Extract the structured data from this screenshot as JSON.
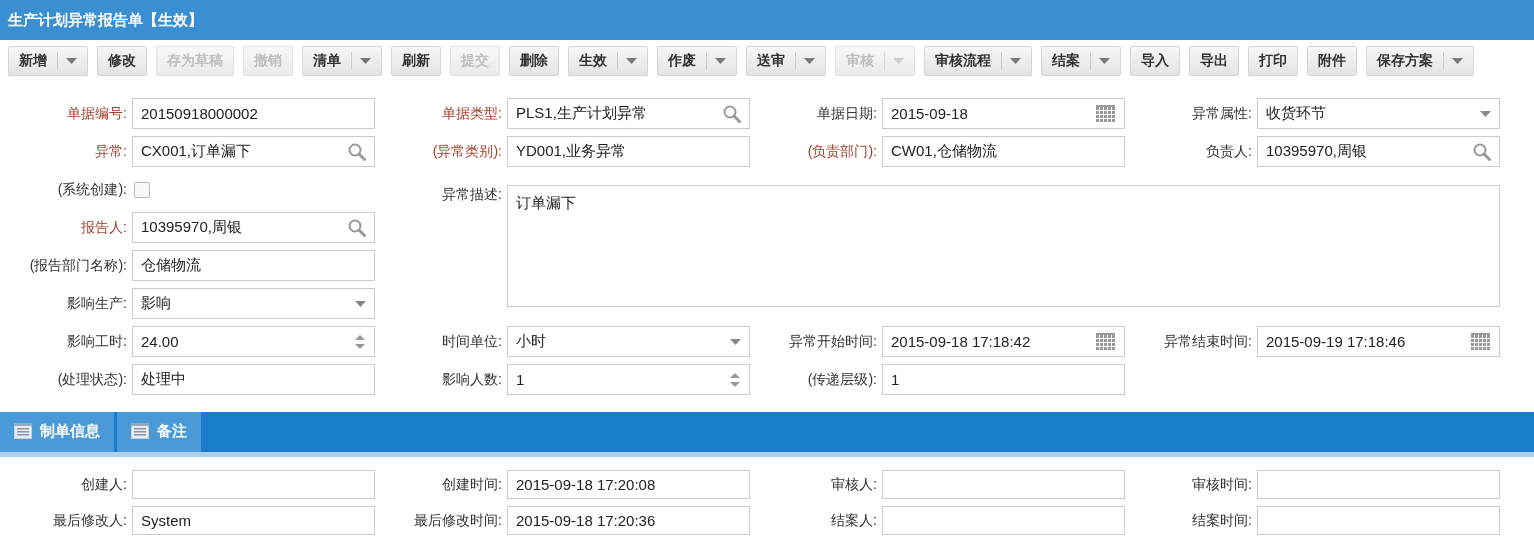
{
  "title": "生产计划异常报告单【生效】",
  "toolbar": [
    {
      "label": "新增",
      "dropdown": true,
      "disabled": false
    },
    {
      "label": "修改",
      "dropdown": false,
      "disabled": false
    },
    {
      "label": "存为草稿",
      "dropdown": false,
      "disabled": true
    },
    {
      "label": "撤销",
      "dropdown": false,
      "disabled": true
    },
    {
      "label": "清单",
      "dropdown": true,
      "disabled": false
    },
    {
      "label": "刷新",
      "dropdown": false,
      "disabled": false
    },
    {
      "label": "提交",
      "dropdown": false,
      "disabled": true
    },
    {
      "label": "删除",
      "dropdown": false,
      "disabled": false
    },
    {
      "label": "生效",
      "dropdown": true,
      "disabled": false
    },
    {
      "label": "作废",
      "dropdown": true,
      "disabled": false
    },
    {
      "label": "送审",
      "dropdown": true,
      "disabled": false
    },
    {
      "label": "审核",
      "dropdown": true,
      "disabled": true
    },
    {
      "label": "审核流程",
      "dropdown": true,
      "disabled": false
    },
    {
      "label": "结案",
      "dropdown": true,
      "disabled": false
    },
    {
      "label": "导入",
      "dropdown": false,
      "disabled": false
    },
    {
      "label": "导出",
      "dropdown": false,
      "disabled": false
    },
    {
      "label": "打印",
      "dropdown": false,
      "disabled": false
    },
    {
      "label": "附件",
      "dropdown": false,
      "disabled": false
    },
    {
      "label": "保存方案",
      "dropdown": true,
      "disabled": false
    }
  ],
  "form": [
    {
      "label": "单据编号:",
      "required": true,
      "kind": "text",
      "value": "20150918000002"
    },
    {
      "label": "单据类型:",
      "required": true,
      "kind": "lookup",
      "value": "PLS1,生产计划异常"
    },
    {
      "label": "单据日期:",
      "required": false,
      "kind": "date",
      "value": "2015-09-18"
    },
    {
      "label": "异常属性:",
      "required": false,
      "kind": "select",
      "value": "收货环节"
    },
    {
      "label": "异常:",
      "required": true,
      "kind": "lookup",
      "value": "CX001,订单漏下"
    },
    {
      "label": "(异常类别):",
      "required": true,
      "kind": "text",
      "value": "YD001,业务异常"
    },
    {
      "label": "(负责部门):",
      "required": true,
      "kind": "text",
      "value": "CW01,仓储物流"
    },
    {
      "label": "负责人:",
      "required": false,
      "kind": "lookup",
      "value": "10395970,周银"
    },
    {
      "label": "(系统创建):",
      "required": false,
      "kind": "checkbox",
      "checked": false
    },
    {
      "label": "异常描述:",
      "required": false,
      "kind": "textarea",
      "value": "订单漏下"
    },
    {
      "label": "报告人:",
      "required": true,
      "kind": "lookup",
      "value": "10395970,周银"
    },
    {
      "label": "(报告部门名称):",
      "required": false,
      "kind": "text",
      "value": "仓储物流"
    },
    {
      "label": "影响生产:",
      "required": false,
      "kind": "select",
      "value": "影响"
    },
    {
      "label": "影响工时:",
      "required": false,
      "kind": "number",
      "value": "24.00"
    },
    {
      "label": "时间单位:",
      "required": false,
      "kind": "select",
      "value": "小时"
    },
    {
      "label": "异常开始时间:",
      "required": false,
      "kind": "date",
      "value": "2015-09-18 17:18:42"
    },
    {
      "label": "异常结束时间:",
      "required": false,
      "kind": "date",
      "value": "2015-09-19 17:18:46"
    },
    {
      "label": "(处理状态):",
      "required": false,
      "kind": "text",
      "value": "处理中"
    },
    {
      "label": "影响人数:",
      "required": false,
      "kind": "number",
      "value": "1"
    },
    {
      "label": "(传递层级):",
      "required": false,
      "kind": "text",
      "value": "1"
    }
  ],
  "tabs": [
    {
      "label": "制单信息"
    },
    {
      "label": "备注"
    }
  ],
  "audit": [
    {
      "label": "创建人:",
      "required": false,
      "kind": "text"
    },
    {
      "label": "创建时间:",
      "required": false,
      "kind": "text",
      "value": "2015-09-18 17:20:08"
    },
    {
      "label": "审核人:",
      "required": false,
      "kind": "text"
    },
    {
      "label": "审核时间:",
      "required": false,
      "kind": "text"
    },
    {
      "label": "最后修改人:",
      "required": false,
      "kind": "text",
      "value": "System"
    },
    {
      "label": "最后修改时间:",
      "required": false,
      "kind": "text",
      "value": "2015-09-18 17:20:36"
    },
    {
      "label": "结案人:",
      "required": false,
      "kind": "text"
    },
    {
      "label": "结案时间:",
      "required": false,
      "kind": "text"
    }
  ]
}
